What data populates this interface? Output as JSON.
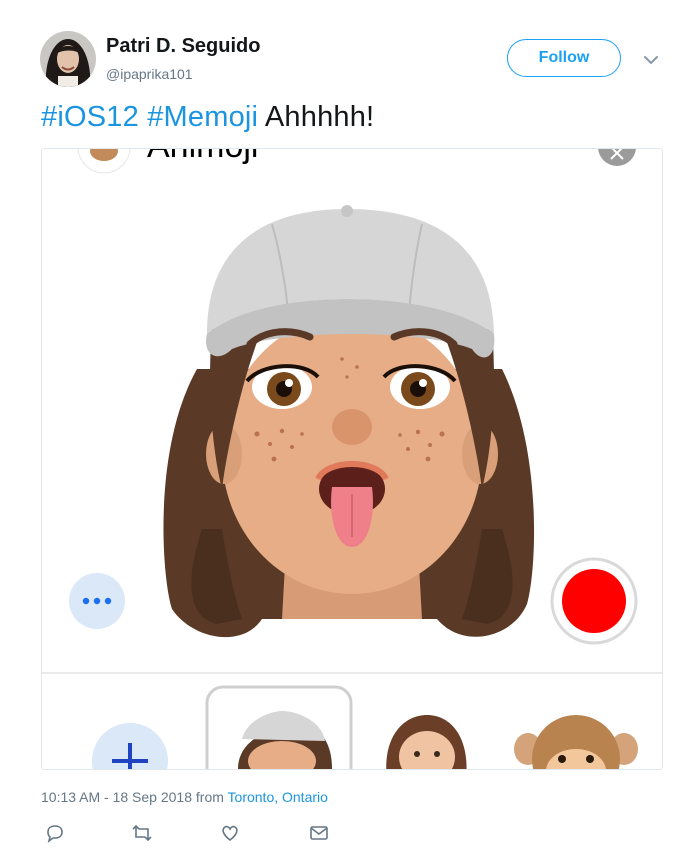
{
  "author": {
    "display_name": "Patri D. Seguido",
    "handle": "@ipaprika101"
  },
  "follow_button": {
    "label": "Follow"
  },
  "tweet": {
    "hashtag_1": "#iOS12",
    "hashtag_2": "#Memoji",
    "text": "Ahhhhh!"
  },
  "media": {
    "header_title": "Animoji",
    "record_button_color": "#ff0000"
  },
  "meta": {
    "timestamp": "10:13 AM - 18 Sep 2018 from ",
    "location": "Toronto, Ontario"
  },
  "icons": [
    "reply-icon",
    "retweet-icon",
    "like-icon",
    "direct-message-icon"
  ],
  "colors": {
    "accent": "#1da1f2",
    "hashtag": "#1b95e0",
    "muted": "#657786"
  }
}
